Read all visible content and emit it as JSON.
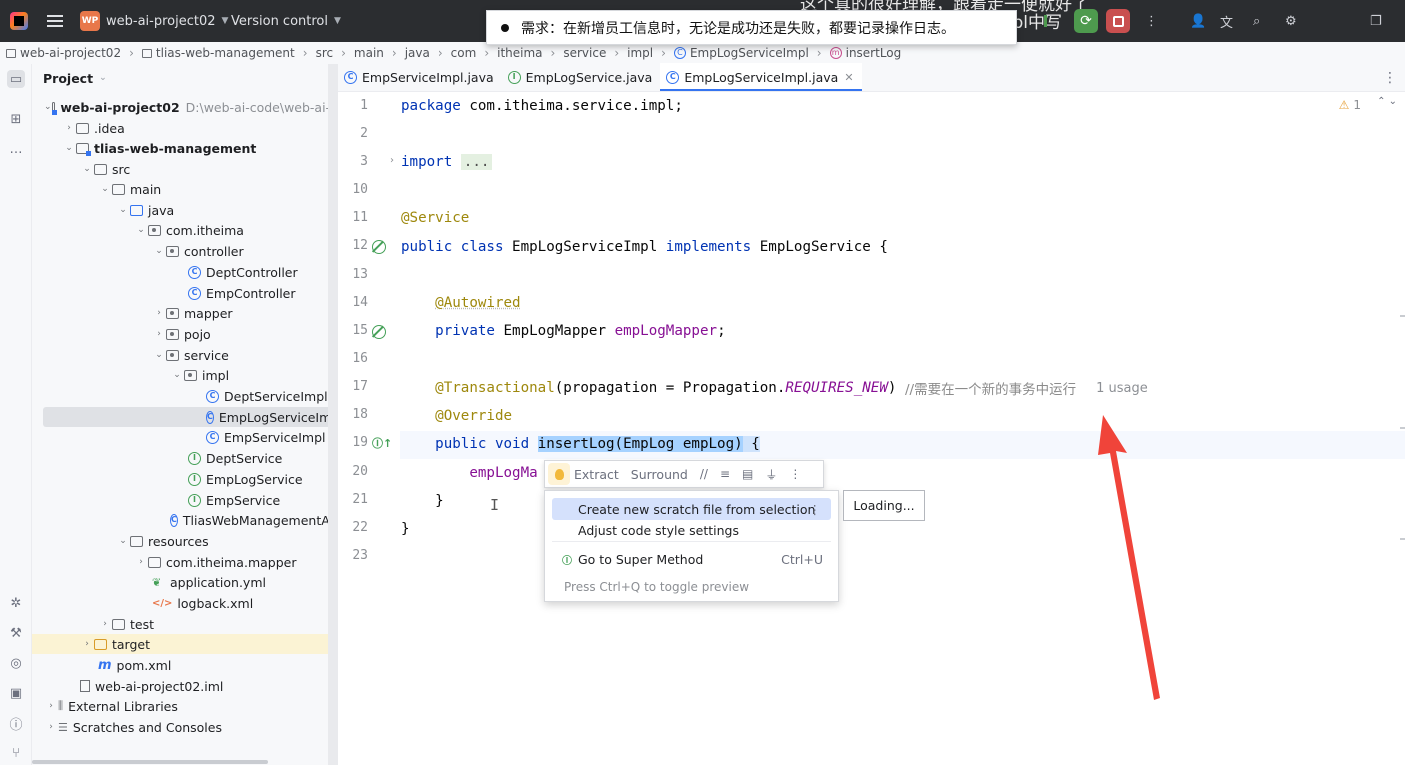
{
  "caption": {
    "top_line": "这个真的很好理解，跟着走一便就好了",
    "mid_line": "为啥不在EmpServiceImpl中写"
  },
  "titlebar": {
    "project_badge": "WP",
    "project_name": "web-ai-project02",
    "vcs_label": "Version control"
  },
  "notification": {
    "text": "需求：在新增员工信息时，无论是成功还是失败，都要记录操作日志。"
  },
  "breadcrumb": [
    "web-ai-project02",
    "tlias-web-management",
    "src",
    "main",
    "java",
    "com",
    "itheima",
    "service",
    "impl",
    "EmpLogServiceImpl",
    "insertLog"
  ],
  "project_panel": {
    "title": "Project",
    "tree": [
      {
        "label": "web-ai-project02",
        "path": "D:\\web-ai-code\\web-ai-p"
      },
      {
        "label": ".idea"
      },
      {
        "label": "tlias-web-management"
      },
      {
        "label": "src"
      },
      {
        "label": "main"
      },
      {
        "label": "java"
      },
      {
        "label": "com.itheima"
      },
      {
        "label": "controller"
      },
      {
        "label": "DeptController"
      },
      {
        "label": "EmpController"
      },
      {
        "label": "mapper"
      },
      {
        "label": "pojo"
      },
      {
        "label": "service"
      },
      {
        "label": "impl"
      },
      {
        "label": "DeptServiceImpl"
      },
      {
        "label": "EmpLogServiceImpl"
      },
      {
        "label": "EmpServiceImpl"
      },
      {
        "label": "DeptService"
      },
      {
        "label": "EmpLogService"
      },
      {
        "label": "EmpService"
      },
      {
        "label": "TliasWebManagementApp"
      },
      {
        "label": "resources"
      },
      {
        "label": "com.itheima.mapper"
      },
      {
        "label": "application.yml"
      },
      {
        "label": "logback.xml"
      },
      {
        "label": "test"
      },
      {
        "label": "target"
      },
      {
        "label": "pom.xml"
      },
      {
        "label": "web-ai-project02.iml"
      },
      {
        "label": "External Libraries"
      },
      {
        "label": "Scratches and Consoles"
      }
    ]
  },
  "tabs": [
    {
      "label": "EmpServiceImpl.java"
    },
    {
      "label": "EmpLogService.java"
    },
    {
      "label": "EmpLogServiceImpl.java"
    }
  ],
  "editor": {
    "warning_count": "1",
    "line_numbers": [
      "1",
      "2",
      "3",
      "10",
      "11",
      "12",
      "13",
      "14",
      "15",
      "16",
      "17",
      "18",
      "19",
      "20",
      "21",
      "22",
      "23"
    ],
    "code": {
      "l1_kw": "package",
      "l1_rest": " com.itheima.service.impl;",
      "l3_kw": "import",
      "l3_dots": "...",
      "l11": "@Service",
      "l12_kw1": "public class",
      "l12_name": " EmpLogServiceImpl ",
      "l12_kw2": "implements",
      "l12_rest": " EmpLogService {",
      "l14": "@Autowired",
      "l15_kw": "private",
      "l15_type": " EmpLogMapper ",
      "l15_field": "empLogMapper",
      "l15_end": ";",
      "l17_ann": "@Transactional",
      "l17_mid": "(propagation = Propagation.",
      "l17_const": "REQUIRES_NEW",
      "l17_end": ") ",
      "l17_comment": "//需要在一个新的事务中运行",
      "l17_usage": "1 usage",
      "l18": "@Override",
      "l19_kw": "public void",
      "l19_sel": "insertLog(EmpLog empLog)",
      "l19_end": " {",
      "l20": "empLogMa",
      "l21": "}",
      "l22": "}"
    }
  },
  "intention_toolbar": {
    "extract": "Extract",
    "surround": "Surround"
  },
  "popup_menu": {
    "items": [
      {
        "label": "Create new scratch file from selection"
      },
      {
        "label": "Adjust code style settings"
      },
      {
        "label": "Go to Super Method",
        "shortcut": "Ctrl+U"
      }
    ],
    "footer": "Press Ctrl+Q to toggle preview"
  },
  "preview": {
    "loading": "Loading..."
  },
  "colors": {
    "titlebar_bg": "#2b2d30",
    "accent": "#3574f0",
    "selection": "#a6d2ff",
    "annotation": "#9e880d",
    "keyword": "#0033b3",
    "arrow_red": "#f0443a"
  }
}
